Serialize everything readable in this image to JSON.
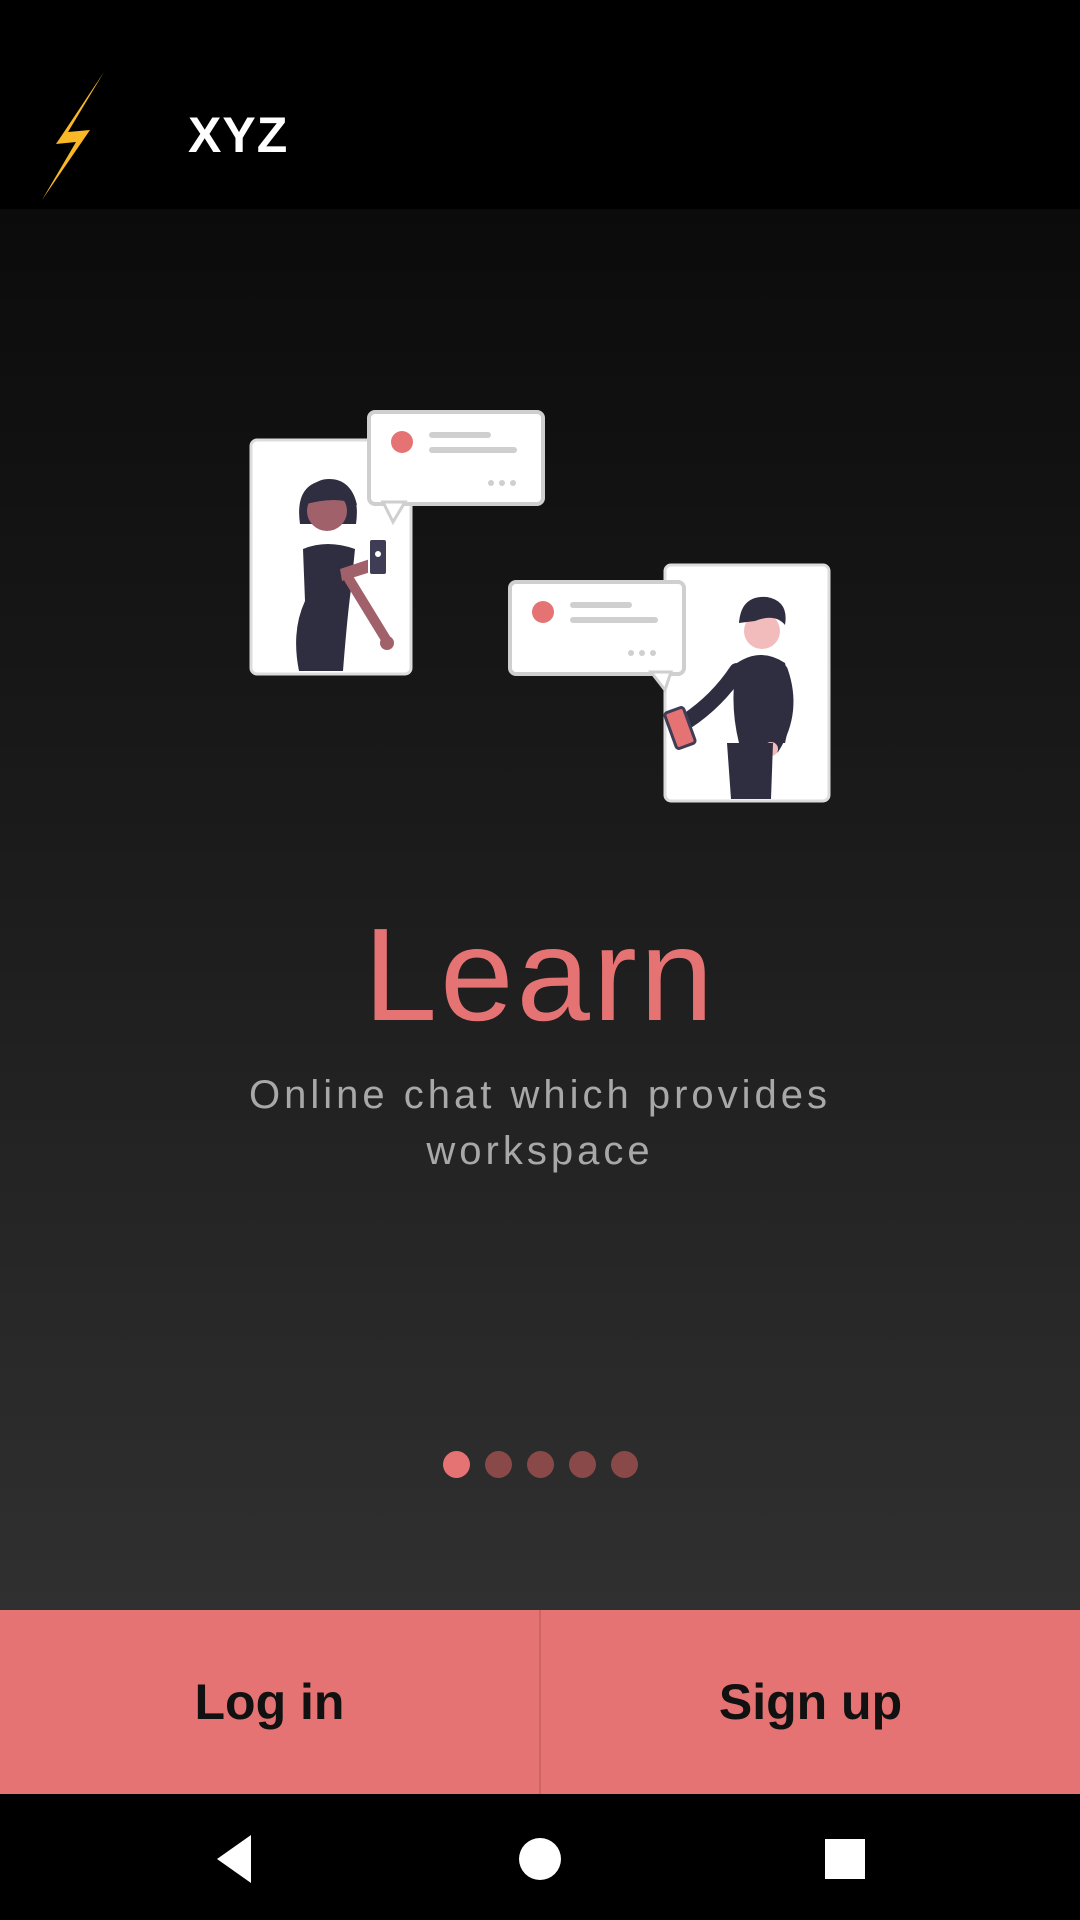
{
  "app_bar": {
    "logo_icon": "lightning-bolt-icon",
    "title": "XYZ"
  },
  "onboarding": {
    "illustration": "two-people-chatting-illustration",
    "headline": "Learn",
    "subtitle": "Online chat which provides workspace",
    "pager": {
      "total_pages": 5,
      "active_index": 0
    }
  },
  "actions": {
    "login_label": "Log in",
    "signup_label": "Sign up"
  },
  "nav_bar": {
    "back_icon": "back-triangle-icon",
    "home_icon": "home-circle-icon",
    "recents_icon": "recents-square-icon"
  },
  "colors": {
    "accent": "#e57373",
    "bolt": "#f9b825",
    "inactive_dot": "#8a4949"
  }
}
